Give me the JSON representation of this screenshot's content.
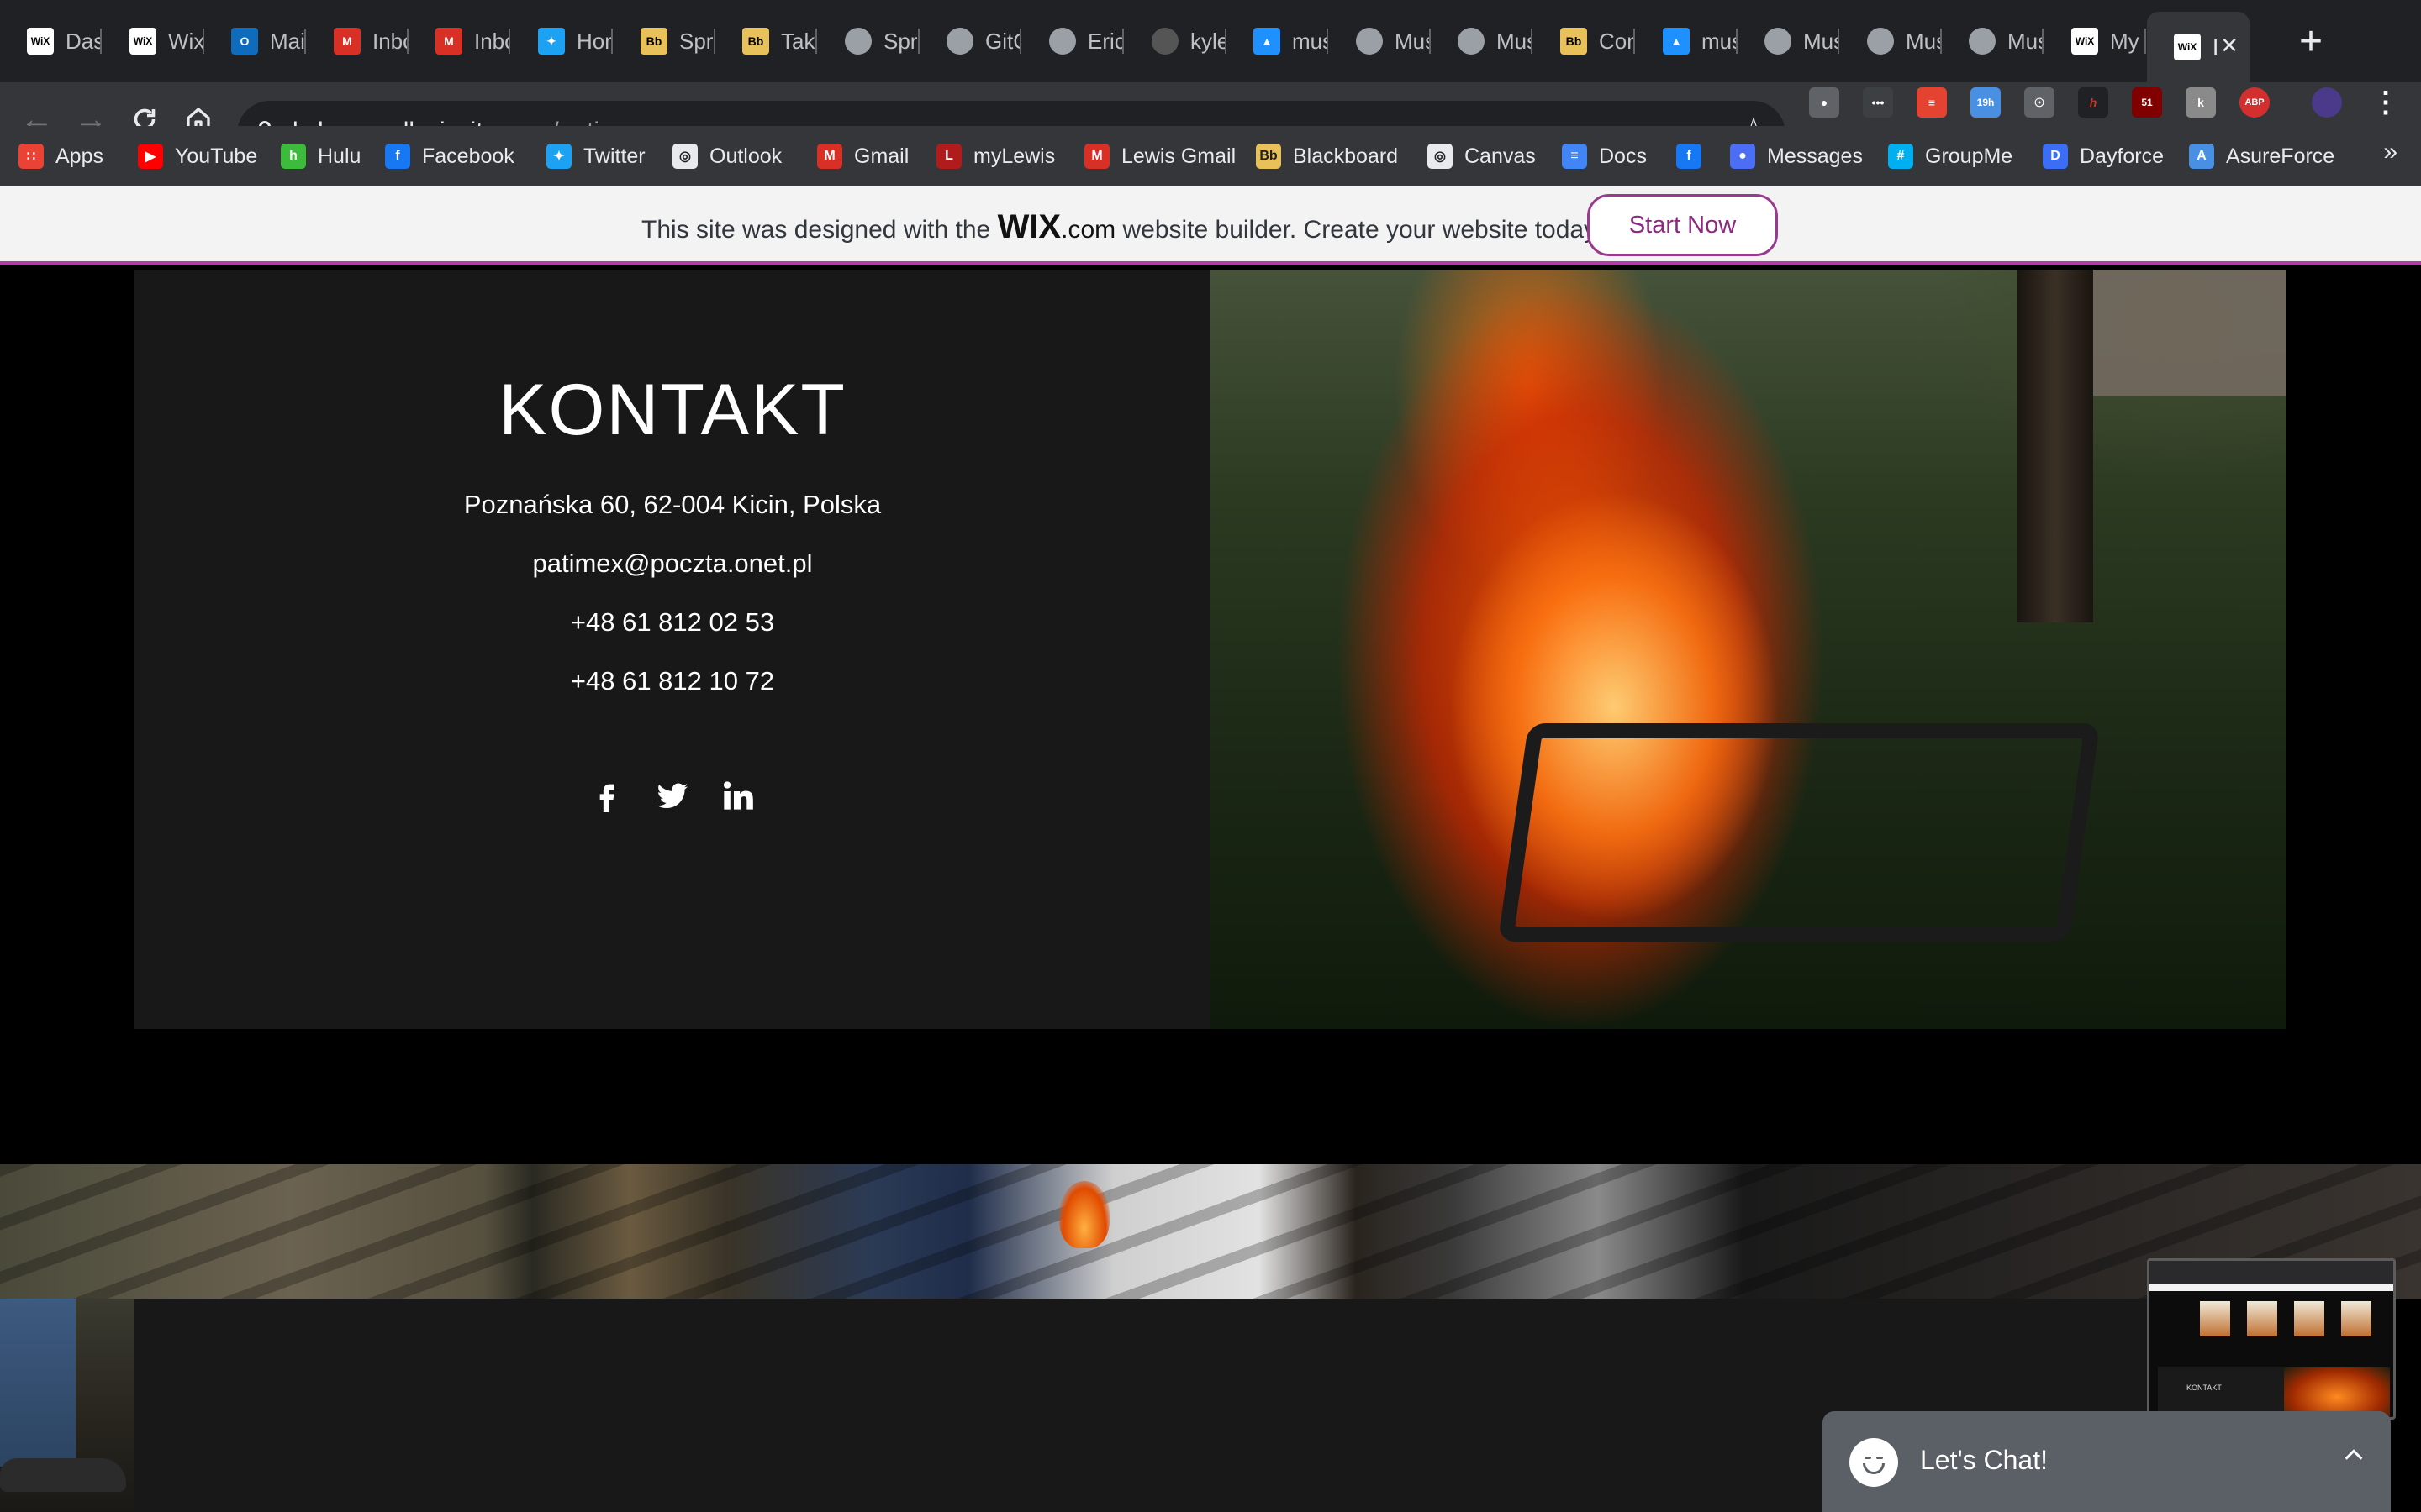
{
  "browser": {
    "tabs": [
      {
        "title": "Das",
        "icon": "wix-icon",
        "color": "#ffffff"
      },
      {
        "title": "Wix",
        "icon": "wix-icon",
        "color": "#ffffff"
      },
      {
        "title": "Mail",
        "icon": "outlook-icon",
        "color": "#0f6cbd"
      },
      {
        "title": "Inbo",
        "icon": "gmail-icon",
        "color": "#d93025"
      },
      {
        "title": "Inbo",
        "icon": "gmail-icon",
        "color": "#d93025"
      },
      {
        "title": "Hon",
        "icon": "twitter-icon",
        "color": "#1da1f2"
      },
      {
        "title": "Spri",
        "icon": "blackboard-icon",
        "color": "#e8c15a"
      },
      {
        "title": "Take",
        "icon": "blackboard-icon",
        "color": "#e8c15a"
      },
      {
        "title": "Spri",
        "icon": "globe-icon",
        "color": "#9aa0a6"
      },
      {
        "title": "GitC",
        "icon": "globe-icon",
        "color": "#9aa0a6"
      },
      {
        "title": "Eric",
        "icon": "globe-icon",
        "color": "#9aa0a6"
      },
      {
        "title": "kyle",
        "icon": "github-icon",
        "color": "#555555"
      },
      {
        "title": "mus",
        "icon": "azure-icon",
        "color": "#1e90ff"
      },
      {
        "title": "Mus",
        "icon": "globe-icon",
        "color": "#9aa0a6"
      },
      {
        "title": "Mus",
        "icon": "globe-icon",
        "color": "#9aa0a6"
      },
      {
        "title": "Con",
        "icon": "blackboard-icon",
        "color": "#e8c15a"
      },
      {
        "title": "mus",
        "icon": "azure-icon",
        "color": "#1e90ff"
      },
      {
        "title": "Mus",
        "icon": "globe-icon",
        "color": "#9aa0a6"
      },
      {
        "title": "Mus",
        "icon": "globe-icon",
        "color": "#9aa0a6"
      },
      {
        "title": "Mus",
        "icon": "globe-icon",
        "color": "#9aa0a6"
      },
      {
        "title": "My",
        "icon": "wix-icon",
        "color": "#ffffff"
      },
      {
        "title": "I",
        "icon": "wix-icon",
        "color": "#ffffff",
        "active": true
      }
    ],
    "url_host": "kylemorrell.wixsite.com",
    "url_path": "/patimex",
    "bookmarks": [
      {
        "label": "Apps",
        "icon": "apps-grid-icon",
        "color": "#ea4335"
      },
      {
        "label": "YouTube",
        "icon": "youtube-icon",
        "color": "#ff0000"
      },
      {
        "label": "Hulu",
        "icon": "hulu-icon",
        "color": "#3dbb3d"
      },
      {
        "label": "Facebook",
        "icon": "facebook-icon",
        "color": "#1877f2"
      },
      {
        "label": "Twitter",
        "icon": "twitter-icon",
        "color": "#1da1f2"
      },
      {
        "label": "Outlook",
        "icon": "globe-icon",
        "color": "#e8eaed"
      },
      {
        "label": "Gmail",
        "icon": "gmail-icon",
        "color": "#d93025"
      },
      {
        "label": "myLewis",
        "icon": "lewis-icon",
        "color": "#b01c1c"
      },
      {
        "label": "Lewis Gmail",
        "icon": "gmail-icon",
        "color": "#d93025"
      },
      {
        "label": "Blackboard",
        "icon": "blackboard-icon",
        "color": "#e8c15a"
      },
      {
        "label": "Canvas",
        "icon": "globe-icon",
        "color": "#e8eaed"
      },
      {
        "label": "Docs",
        "icon": "docs-icon",
        "color": "#4285f4"
      },
      {
        "label": "",
        "icon": "facebook-icon",
        "color": "#1877f2"
      },
      {
        "label": "Messages",
        "icon": "messages-icon",
        "color": "#4c6ef5"
      },
      {
        "label": "GroupMe",
        "icon": "groupme-icon",
        "color": "#00aff0"
      },
      {
        "label": "Dayforce",
        "icon": "dayforce-icon",
        "color": "#3b6ef5"
      },
      {
        "label": "AsureForce",
        "icon": "asureforce-icon",
        "color": "#4a90e2"
      }
    ],
    "extension_badges": {
      "calendar_badge": "19h",
      "ublock_badge": "51",
      "adblock_label": "ABP"
    }
  },
  "wix_banner": {
    "prefix": "This site was designed with the",
    "logo": "WIX",
    "logo_suffix": ".com",
    "suffix": "website builder. Create your website today.",
    "button": "Start Now"
  },
  "contact": {
    "title": "KONTAKT",
    "address": "Poznańska 60, 62-004 Kicin, Polska",
    "email": "patimex@poczta.onet.pl",
    "phone1": "+48 61 812 02 53",
    "phone2": "+48 61 812 10 72"
  },
  "chat": {
    "label": "Let's Chat!"
  },
  "preview": {
    "title": "KONTAKT"
  }
}
